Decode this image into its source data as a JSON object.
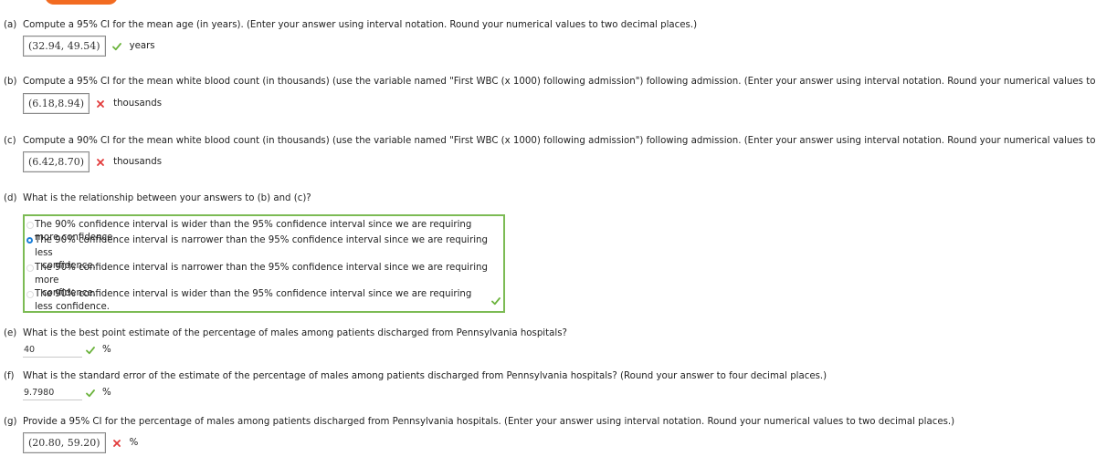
{
  "top_button": {
    "label": ""
  },
  "colors": {
    "accent_orange": "#f26b21",
    "correct_green": "#6bb33c",
    "incorrect_red": "#e23b3b",
    "selected_blue": "#1a7fd8",
    "mc_border_green": "#7cbb54"
  },
  "parts": {
    "a": {
      "letter": "(a)",
      "question": "Compute a 95% CI for the mean age (in years). (Enter your answer using interval notation. Round your numerical values to two decimal places.)",
      "answer": "(32.94, 49.54)",
      "status": "correct",
      "status_icon": "check-icon",
      "unit": "years"
    },
    "b": {
      "letter": "(b)",
      "question": "Compute a 95% CI for the mean white blood count (in thousands) (use the variable named \"First WBC (x 1000) following admission\") following admission. (Enter your answer using interval notation. Round your numerical values to two decimal places.)",
      "answer": "(6.18,8.94)",
      "status": "incorrect",
      "status_icon": "cross-icon",
      "unit": "thousands"
    },
    "c": {
      "letter": "(c)",
      "question": "Compute a 90% CI for the mean white blood count (in thousands) (use the variable named \"First WBC (x 1000) following admission\") following admission. (Enter your answer using interval notation. Round your numerical values to two decimal places.)",
      "answer": "(6.42,8.70)",
      "status": "incorrect",
      "status_icon": "cross-icon",
      "unit": "thousands"
    },
    "d": {
      "letter": "(d)",
      "question": "What is the relationship between your answers to (b) and (c)?",
      "status": "correct",
      "options": [
        {
          "line1": "The 90% confidence interval is wider than the 95% confidence interval since we are requiring more confidence.",
          "line2": "",
          "selected": false
        },
        {
          "line1": "The 90% confidence interval is narrower than the 95% confidence interval since we are requiring less",
          "line2": "confidence.",
          "selected": true
        },
        {
          "line1": "The 90% confidence interval is narrower than the 95% confidence interval since we are requiring more",
          "line2": "confidence.",
          "selected": false
        },
        {
          "line1": "The 90% confidence interval is wider than the 95% confidence interval since we are requiring less confidence.",
          "line2": "",
          "selected": false
        }
      ]
    },
    "e": {
      "letter": "(e)",
      "question": "What is the best point estimate of the percentage of males among patients discharged from Pennsylvania hospitals?",
      "answer": "40",
      "status": "correct",
      "status_icon": "check-icon",
      "unit": "%"
    },
    "f": {
      "letter": "(f)",
      "question": "What is the standard error of the estimate of the percentage of males among patients discharged from Pennsylvania hospitals? (Round your answer to four decimal places.)",
      "answer": "9.7980",
      "status": "correct",
      "status_icon": "check-icon",
      "unit": "%"
    },
    "g": {
      "letter": "(g)",
      "question": "Provide a 95% CI for the percentage of males among patients discharged from Pennsylvania hospitals. (Enter your answer using interval notation. Round your numerical values to two decimal places.)",
      "answer": "(20.80, 59.20)",
      "status": "incorrect",
      "status_icon": "cross-icon",
      "unit": "%"
    }
  }
}
